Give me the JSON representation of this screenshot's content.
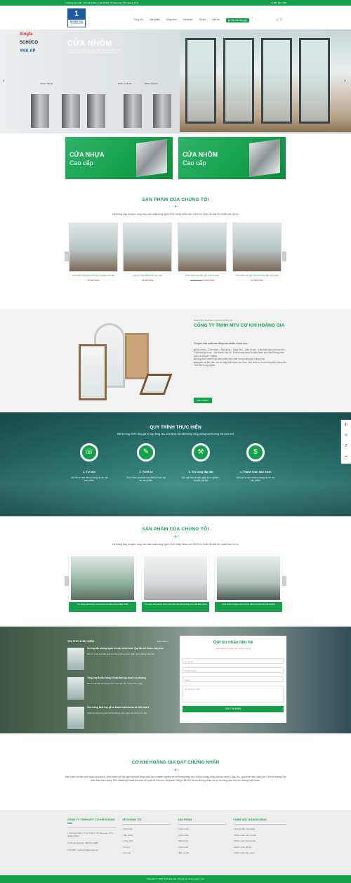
{
  "topbar": {
    "address": "Xưởng sản xuất : 463 Hà Khánh, p Hà Khánh, TP Hạ Long, Tỉnh Quảng Ninh",
    "phone": "089 611 2468"
  },
  "logo": {
    "number": "1",
    "name": "HOÀNG GIA",
    "slogan": "Chất lượng hàng đầu"
  },
  "nav": {
    "items": [
      "Trang chủ",
      "Sản phẩm",
      "Công trình",
      "Giới thiệu",
      "Tin tức",
      "Liên hệ"
    ],
    "cta": "Yêu cầu báo giá",
    "cart_icon": "cart-icon",
    "search_icon": "search-icon"
  },
  "hero": {
    "brands": [
      "Xingfa",
      "SCHÜCO",
      "YKK AP"
    ],
    "title": "CỬA NHÔM",
    "description": "Cửa hệ khung viền chắc chắn mang lại sự bền vững, an toàn cho công trình và sự yên tâm cho người sử dụng",
    "profiles": [
      "Nhôm Xingfa",
      "Nhôm YKK AP",
      "Nhôm Schuco"
    ]
  },
  "banners": [
    {
      "line1": "CỬA NHỰA",
      "line2": "Cao cấp"
    },
    {
      "line1": "CỬA NHÔM",
      "line2": "Cao cấp"
    }
  ],
  "products_section": {
    "title": "SẢN PHẨM CỦA CHÚNG TÔI",
    "desc": "Hệ thống dây chuyền, máy móc sản xuất công nghệ CNC nhập khẩu mới 100% từ Châu Âu đạt độ chuẩn xác tối ưu",
    "items": [
      {
        "name": "Cửa kính cường lực vân gỗ phụ kiện cao cấp",
        "price": "35.000.000đ",
        "old": ""
      },
      {
        "name": "Cửa đi YKK MDS kính cao cấp",
        "price": "15.000.000đ",
        "old": ""
      },
      {
        "name": "Cửa nhôm cao cấp xếp trượt 6 cánh",
        "price": "20.000.000đ",
        "old": "22.000.000đ"
      },
      {
        "name": "Cửa nhôm Xingfa mở trượt cao cấp hàng thật",
        "price": "35.000.000đ",
        "old": ""
      }
    ]
  },
  "about": {
    "kicker": "NHÀ HIỆU NGÀNH CỬA CAO CẤP CỦA",
    "title": "CÔNG TY TNHH MTV CƠ KHÍ HOÀNG GIA",
    "intro": "Chuyên sản xuất các dòng sản phẩm chính như :",
    "points": [
      "Cửa nhựa – Cửa nhôm – Mặt dựng – Vách kính – Bàn tủ sàn – Hầu kính đẹp với mục tiêu “Chất lượng từ uy – Giá thành Xây tự”. Chất lượng châu Âu Bảo hành chu đáo Phong cách phục vụ chuyên nghiệp",
      "Không kinh doanh các sản phẩm kém chất lượng hàng giả, hàng nhái",
      "Nguyên vật liệu đầu vào rõ ràng nhất được lựa chọn meo khấu lo lực thương hiệu hàng đầu Thế Giới trong ngành."
    ],
    "button": "XEM THÊM"
  },
  "process": {
    "title": "QUY TRÌNH THỰC HIỆN",
    "desc": "Bắt thường 300% tổng giá trị hợp đồng nếu Cửa được lấp đặt không đúng chủng loại thương hiệu cam kết",
    "steps": [
      {
        "icon": "consult-icon",
        "glyph": "☏",
        "title": "1. Tư vấn",
        "desc": "Liên hệ tư vấn về số lượng dự án mà sản phẩm"
      },
      {
        "icon": "design-icon",
        "glyph": "✎",
        "title": "2. Thiết kế",
        "desc": "Phác thảo và chỉnh sửa thiết kế cho dự án sản phẩm"
      },
      {
        "icon": "install-icon",
        "glyph": "⚒",
        "title": "3. Thi công lắp đặt",
        "desc": "Đội ngũ thợ chuyên giàu kinh nghiệm, chuyên nghiệp"
      },
      {
        "icon": "payment-icon",
        "glyph": "$",
        "title": "4. Thanh toán bảo hành",
        "desc": "Liên hệ tư vấn và bảo lượng dự án mà sản phẩm"
      }
    ]
  },
  "projects_section": {
    "title": "SẢN PHẨM CỦA CHÚNG TÔI",
    "desc": "Hệ thống dây chuyền, máy móc sản xuất công nghệ CNC nhập khẩu mới 100% từ Châu Âu đạt độ chuẩn xác tối ưu",
    "items": [
      "Thi công vách kính cường lực tại Văn phòng Bảo Phát",
      "Thi công cửa nhôm kính của toàn thể văn phòng cao cấp Bà Chiểu",
      "Cửa nhôm Xingfa xếp trượt 6 cánh tại biệt thự Hà Khánh"
    ]
  },
  "news": {
    "title": "TIN TỨC & SỰ KIỆN",
    "all": "Xem thêm",
    "items": [
      {
        "title": "Hướng dẫn phòng ngừa thế nào là tốt nhất! Quy tắc kết thành chạy bạn",
        "desc": "Bảo trì và vệ sinh bảo phải có chủng hướng cách ngăn ngừa những nhất định"
      },
      {
        "title": "Tổng hợp 8 mẫu trang trí bàn làm đẹp được ưa chuộng",
        "desc": "Bảo trì bàn đầu và không chỉnh thác các mẫu mạng thông dụng"
      },
      {
        "title": "Cửa thang kính hay gỗ và thanh loại cửa tốt và thiết nhà ở",
        "desc": "Nhiều kỹ năng từng loại kinh tế không cách ngăn các phương ở nhà"
      }
    ]
  },
  "contact_form": {
    "title": "Gửi tin nhắn liên hệ",
    "subtitle": "Giải quyết mọi thắc mắc nhanh chóng",
    "fields": [
      "Họ và tên",
      "Số điện thoại",
      "Email",
      "Nội dung tin nhắn"
    ],
    "submit": "GỬI TIN NHẮN"
  },
  "cert": {
    "title": "CƠ KHÍ HOÀNG GIA ĐẠT CHỨNG NHẬN",
    "desc": "Hân hạnh và đón sản xuất cửa nhựa, cửa nhôm với độ ngộ kỹ thuật được đào tạo chuyên nghiệp và hệ thống máy móc thiết bị nhập khẩu tại các nước Châu Âu, quy trình sản xuất của Cơ khí Hoàng Gia đảm bảo theo đúng Tiêu chuẩn kỹ thuật của bản vẽ quốc tế Schuco, Aluplast, Hãng YKK AP, được chứng nhận và uy tín hàng đầu trên thị trường Việt Nam."
  },
  "footer": {
    "company": "CÔNG TY TNHH MTV CƠ KHÍ HOÀNG GIA",
    "address": "463 Hà Khánh, P Hà Khánh, TP Hạ Long, Tỉnh Quảng Ninh",
    "phone": "Phone Number: 089 611 2468",
    "email": "E-Mail: yogihoang@gmail.com",
    "col2": {
      "title": "VỀ CHÚNG TÔI",
      "items": [
        "Giới thiệu",
        "Sản phẩm",
        "Công trình",
        "Tin tức",
        "Liên hệ"
      ]
    },
    "col3": {
      "title": "SẢN PHẨM",
      "items": [
        "Cửa nhựa",
        "Cửa nhôm",
        "Mặt dựng",
        "Vách kính",
        "Bàn tủ sàn"
      ]
    },
    "col4": {
      "title": "CHĂM SÓC KHÁCH HÀNG",
      "items": [
        "Hướng dẫn mua hàng",
        "Chính sách vận chuyển",
        "Chính sách thanh toán",
        "Chính sách đổi trả",
        "Chính sách bảo hành"
      ]
    }
  },
  "copyright": "Copyright © 2021 by Hoàng Gia | Design by webnewtech.com",
  "colors": {
    "primary": "#16a04b",
    "price": "#e02020",
    "logo": "#1a5aa6"
  }
}
